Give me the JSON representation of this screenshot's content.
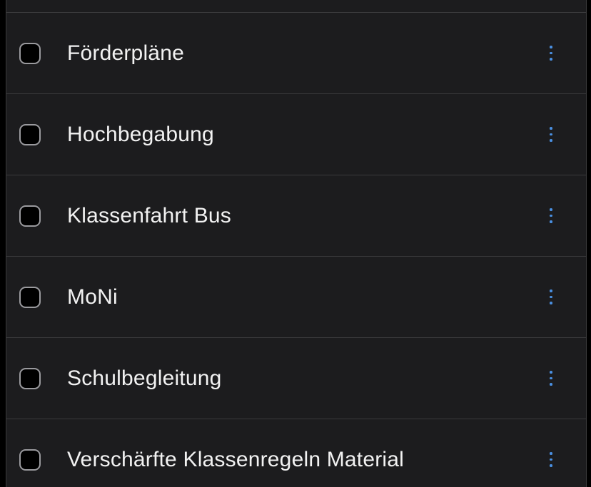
{
  "colors": {
    "background": "#1c1c1e",
    "separator": "#3a3a3c",
    "text": "#f2f2f2",
    "checkbox_border": "#9a9a9e",
    "accent": "#4a90e2"
  },
  "list": {
    "items": [
      {
        "label": "Förderpläne",
        "checked": false,
        "icon": "more-vertical-icon"
      },
      {
        "label": "Hochbegabung",
        "checked": false,
        "icon": "more-vertical-icon"
      },
      {
        "label": "Klassenfahrt Bus",
        "checked": false,
        "icon": "more-vertical-icon"
      },
      {
        "label": "MoNi",
        "checked": false,
        "icon": "more-vertical-icon"
      },
      {
        "label": "Schulbegleitung",
        "checked": false,
        "icon": "more-vertical-icon"
      },
      {
        "label": "Verschärfte Klassenregeln Material",
        "checked": false,
        "icon": "more-vertical-icon"
      }
    ]
  }
}
